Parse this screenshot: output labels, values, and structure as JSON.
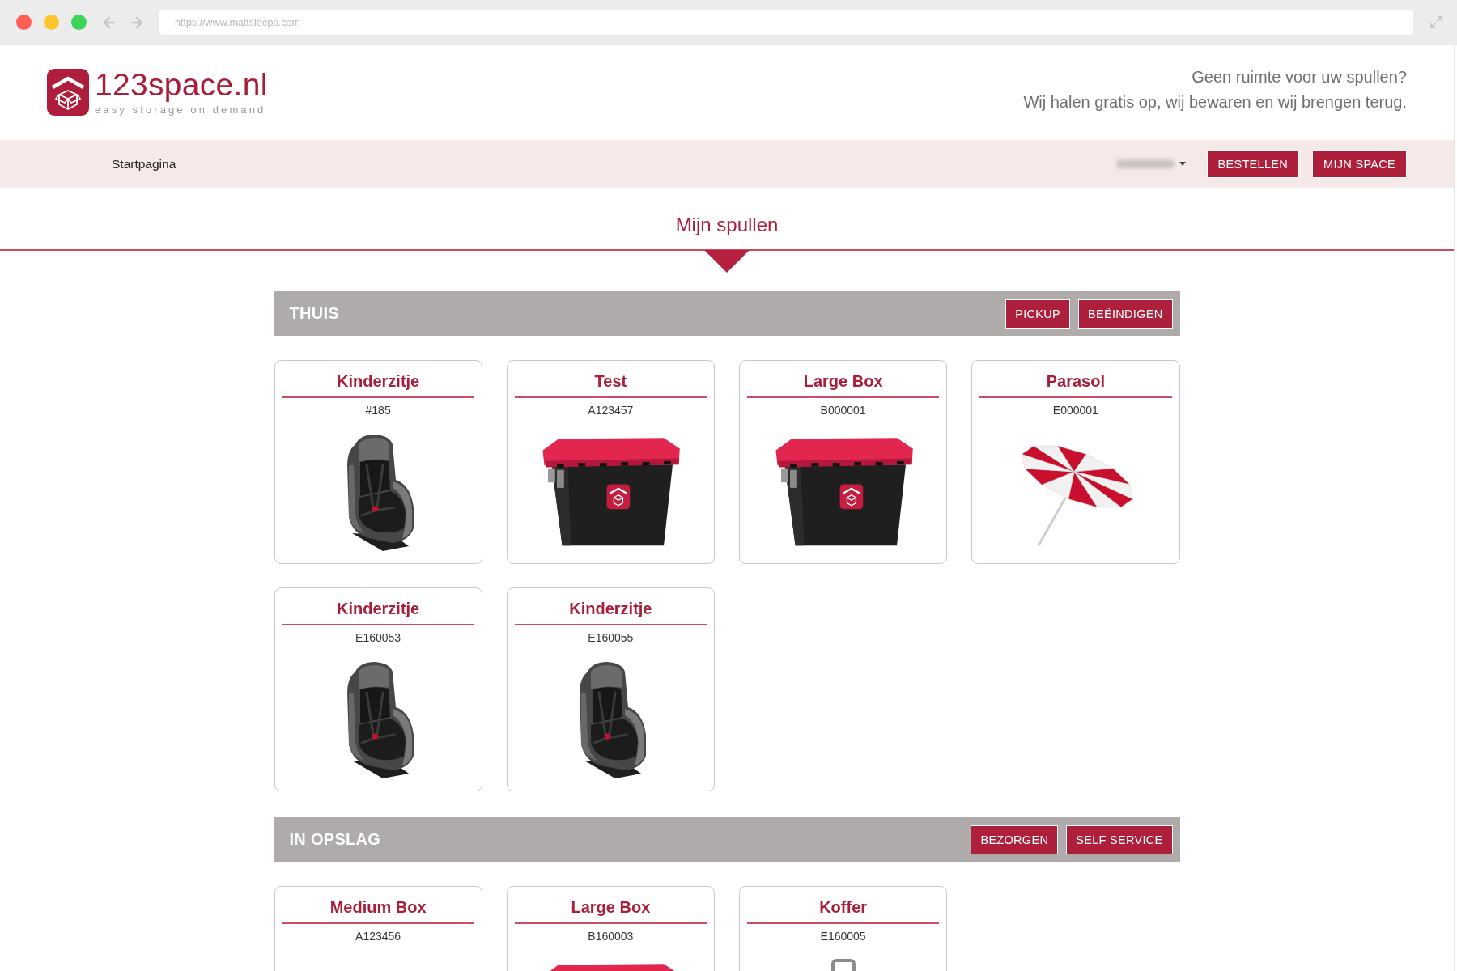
{
  "browser": {
    "url": "https://www.mattsleeps.com"
  },
  "header": {
    "brand": "123space.nl",
    "tagline": "easy storage on demand",
    "slogan": [
      "Geen ruimte voor uw spullen?",
      "Wij halen gratis op, wij bewaren en wij brengen terug."
    ]
  },
  "nav": {
    "links": [
      "Startpagina"
    ],
    "buttons": [
      "BESTELLEN",
      "MIJN SPACE"
    ]
  },
  "page_title": "Mijn spullen",
  "sections": [
    {
      "title": "THUIS",
      "buttons": [
        "PICKUP",
        "BEËINDIGEN"
      ],
      "items": [
        {
          "name": "Kinderzitje",
          "code": "#185",
          "kind": "car_seat"
        },
        {
          "name": "Test",
          "code": "A123457",
          "kind": "storage_box"
        },
        {
          "name": "Large Box",
          "code": "B000001",
          "kind": "storage_box"
        },
        {
          "name": "Parasol",
          "code": "E000001",
          "kind": "parasol"
        },
        {
          "name": "Kinderzitje",
          "code": "E160053",
          "kind": "car_seat"
        },
        {
          "name": "Kinderzitje",
          "code": "E160055",
          "kind": "car_seat"
        }
      ]
    },
    {
      "title": "IN OPSLAG",
      "buttons": [
        "BEZORGEN",
        "SELF SERVICE"
      ],
      "items": [
        {
          "name": "Medium Box",
          "code": "A123456"
        },
        {
          "name": "Large Box",
          "code": "B160003",
          "kind": "storage_box"
        },
        {
          "name": "Koffer",
          "code": "E160005",
          "kind": "suitcase"
        }
      ]
    }
  ]
}
